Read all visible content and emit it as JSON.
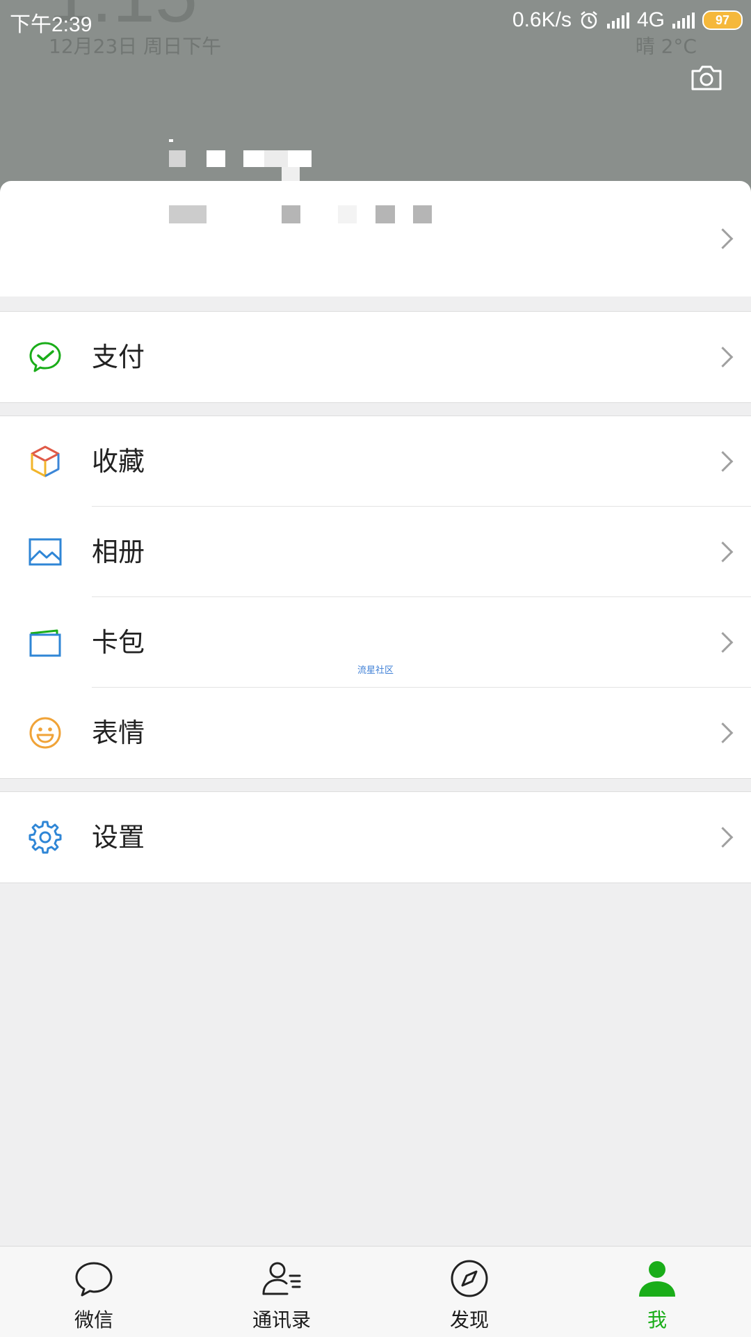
{
  "status_bar": {
    "time": "下午2:39",
    "network_speed": "0.6K/s",
    "network_type": "4G",
    "battery": "97"
  },
  "lockscreen_bg": {
    "date": "12月23日 周日下午",
    "weather": "晴  2°C"
  },
  "menu": {
    "pay": "支付",
    "favorites": "收藏",
    "album": "相册",
    "cards": "卡包",
    "stickers": "表情",
    "settings": "设置"
  },
  "watermark": "流星社区",
  "tabs": [
    {
      "label": "微信",
      "icon": "chat-bubble-icon"
    },
    {
      "label": "通讯录",
      "icon": "contacts-icon"
    },
    {
      "label": "发现",
      "icon": "compass-icon"
    },
    {
      "label": "我",
      "icon": "person-icon"
    }
  ],
  "colors": {
    "accent": "#1AAD19",
    "header_bg": "#8A8F8C",
    "page_bg": "#EFEFF0"
  }
}
